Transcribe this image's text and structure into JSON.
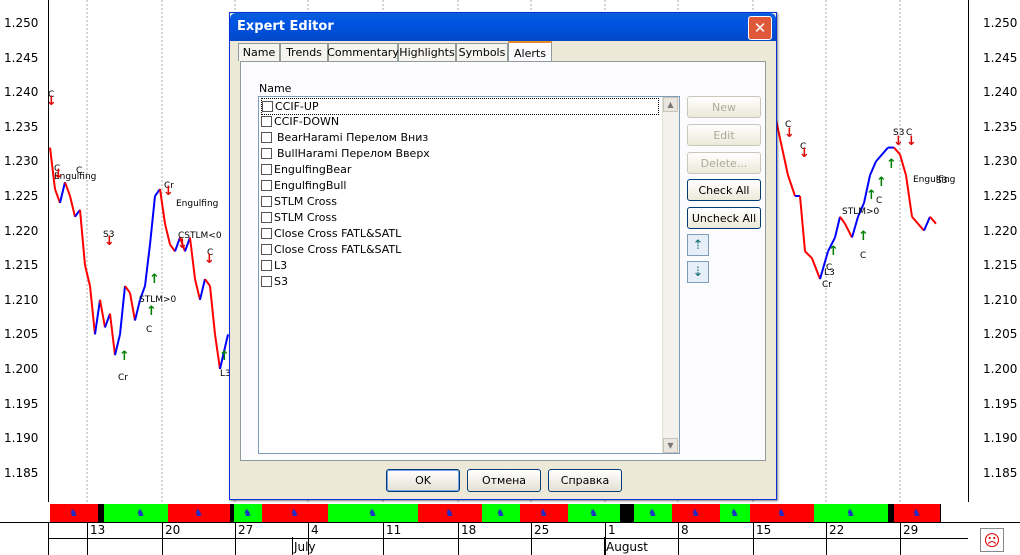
{
  "chart": {
    "price_labels": [
      "1.250",
      "1.245",
      "1.240",
      "1.235",
      "1.230",
      "1.225",
      "1.220",
      "1.215",
      "1.210",
      "1.205",
      "1.200",
      "1.195",
      "1.190",
      "1.185"
    ],
    "day_labels": [
      "13",
      "20",
      "27",
      "4",
      "11",
      "18",
      "25",
      "1",
      "8",
      "15",
      "22",
      "29"
    ],
    "month_labels": [
      "July",
      "August"
    ],
    "annotations": [
      {
        "text": "C"
      },
      {
        "text": "C"
      },
      {
        "text": "Engulfing"
      },
      {
        "text": "C"
      },
      {
        "text": "S3"
      },
      {
        "text": "Cr"
      },
      {
        "text": "STLM>0"
      },
      {
        "text": "C"
      },
      {
        "text": "Cr"
      },
      {
        "text": "Engulfing"
      },
      {
        "text": "CSTLM<0"
      },
      {
        "text": "C"
      },
      {
        "text": "L3"
      },
      {
        "text": "C"
      },
      {
        "text": "C"
      },
      {
        "text": "Cr"
      },
      {
        "text": "C"
      },
      {
        "text": "L3"
      },
      {
        "text": "STLM>0"
      },
      {
        "text": "C"
      },
      {
        "text": "C"
      },
      {
        "text": "S3"
      },
      {
        "text": "C"
      },
      {
        "text": "Engulfing"
      },
      {
        "text": "S3"
      }
    ],
    "colors": {
      "up": "#0000ff",
      "down": "#ff0000",
      "arrow_up": "#008000",
      "arrow_down": "#e00000",
      "bar_green": "#00ff00",
      "bar_red": "#ff0000"
    }
  },
  "dialog": {
    "title": "Expert Editor",
    "close_icon": "close-icon",
    "tabs": [
      "Name",
      "Trends",
      "Commentary",
      "Highlights",
      "Symbols",
      "Alerts"
    ],
    "active_tab": "Alerts",
    "list_header": "Name",
    "items": [
      "CCIF-UP",
      "CCIF-DOWN",
      "BearHarami Перелом Вниз",
      "BullHarami Перелом Вверх",
      "EngulfingBear",
      "EngulfingBull",
      "STLM Cross",
      "STLM Cross",
      "Close Cross FATL&SATL",
      "Close Cross FATL&SATL",
      "L3",
      "S3"
    ],
    "buttons": {
      "new": "New",
      "edit": "Edit",
      "delete": "Delete...",
      "check_all": "Check All",
      "uncheck_all": "Uncheck All"
    },
    "move_up_icon": "move-up-icon",
    "move_down_icon": "move-down-icon",
    "footer": {
      "ok": "OK",
      "cancel": "Отмена",
      "help": "Справка"
    }
  }
}
